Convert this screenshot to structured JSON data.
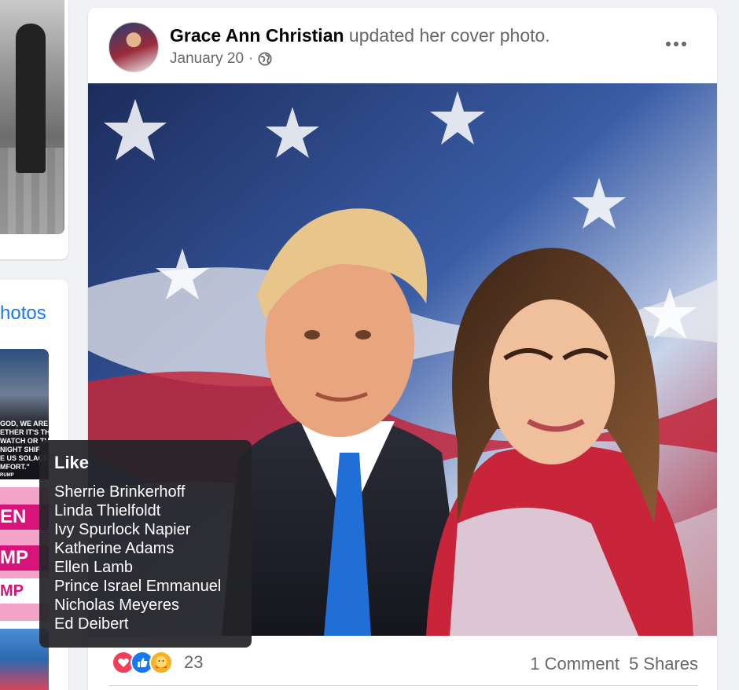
{
  "left_column": {
    "photos_link": "hotos",
    "thumb_quote_lines": [
      "GOD, WE ARE",
      "ETHER IT'S THE",
      "WATCH OR TH",
      "NIGHT SHIF",
      "E US SOLACE",
      "MFORT.\"",
      "RUMP"
    ],
    "thumb_banner_lines": [
      "EN",
      "MP",
      "MP"
    ]
  },
  "post": {
    "author_name": "Grace Ann Christian",
    "action_text": " updated her cover photo.",
    "date": "January 20",
    "separator": "·",
    "privacy_icon": "globe-icon",
    "more_icon": "more-horizontal-icon",
    "reactions": {
      "icons": [
        "love-reaction-icon",
        "like-reaction-icon",
        "care-reaction-icon"
      ],
      "count": "23"
    },
    "comments": "1 Comment",
    "shares": "5 Shares"
  },
  "tooltip": {
    "title": "Like",
    "names": [
      "Sherrie Brinkerhoff",
      "Linda Thielfoldt",
      "Ivy Spurlock Napier",
      "Katherine Adams",
      "Ellen Lamb",
      "Prince Israel Emmanuel",
      "Nicholas Meyeres",
      "Ed Deibert"
    ]
  },
  "colors": {
    "link_blue": "#1877f2",
    "love_red": "#f33e58",
    "care_yellow": "#f7b125",
    "secondary_text": "#65676b"
  }
}
